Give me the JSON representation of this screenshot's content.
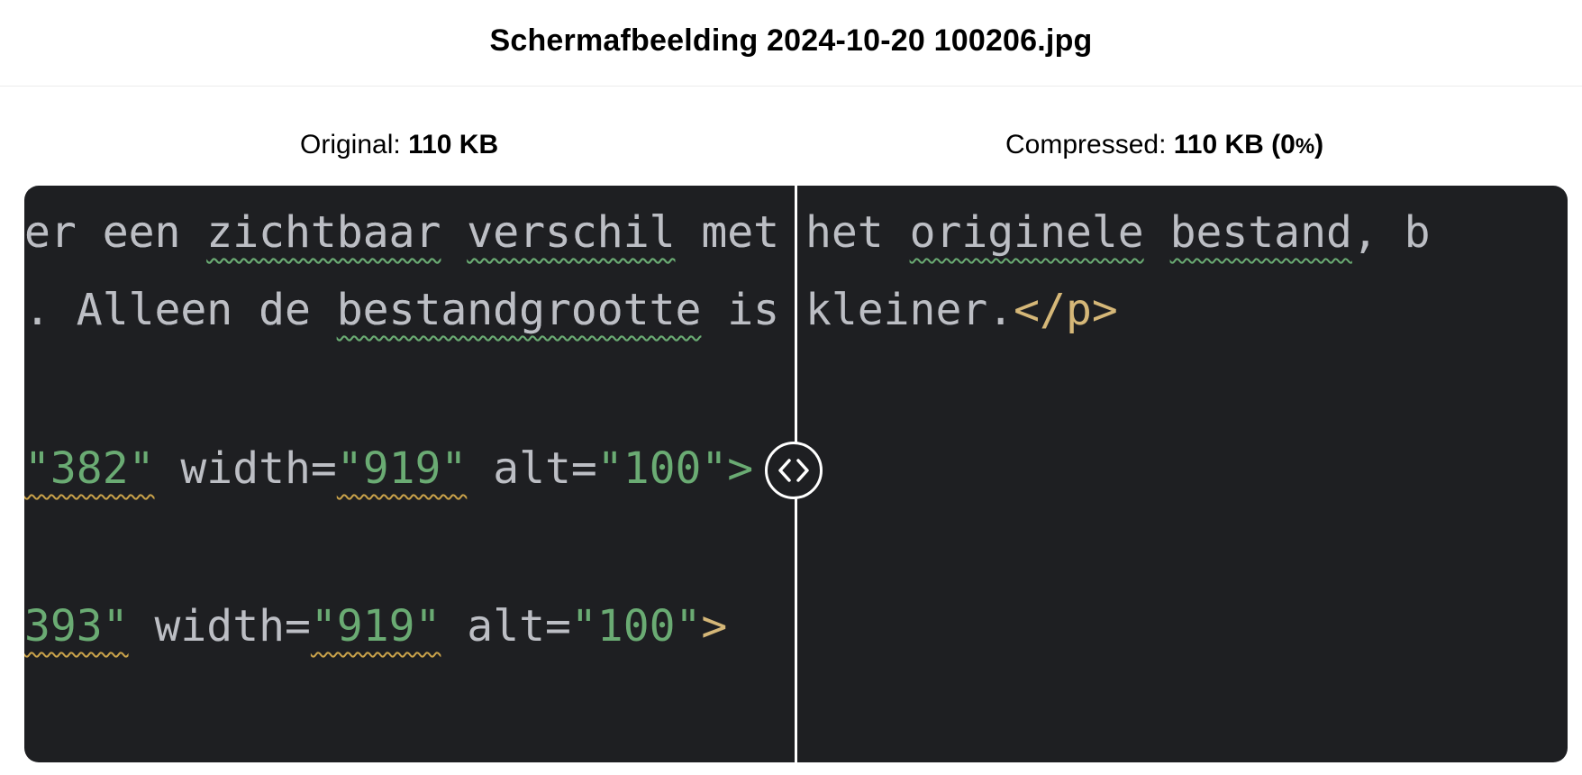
{
  "title": "Schermafbeelding 2024-10-20 100206.jpg",
  "original": {
    "label": "Original:",
    "size": "110 KB"
  },
  "compressed": {
    "label": "Compressed:",
    "size": "110 KB (0",
    "pct": "%",
    "close": ")"
  },
  "code_lines": {
    "line1": [
      "er een ",
      "zichtbaar",
      " ",
      "verschil",
      " met het ",
      "originele",
      " ",
      "bestand",
      ", b"
    ],
    "line2": [
      ". Alleen de ",
      "bestandgrootte",
      " is kleiner.",
      "</p>"
    ],
    "line3": [
      "\"382\"",
      " width=",
      "\"919\"",
      " alt=",
      "\"100\">"
    ],
    "line4": [
      "393\"",
      " width=",
      "\"919\"",
      " alt=",
      "\"100\"",
      ">"
    ]
  },
  "handle_icon": "chevron-left-right-icon",
  "colors": {
    "editor_bg": "#1e1f22",
    "string": "#6aab73",
    "tag": "#d5b778",
    "text": "#bcbec4"
  }
}
